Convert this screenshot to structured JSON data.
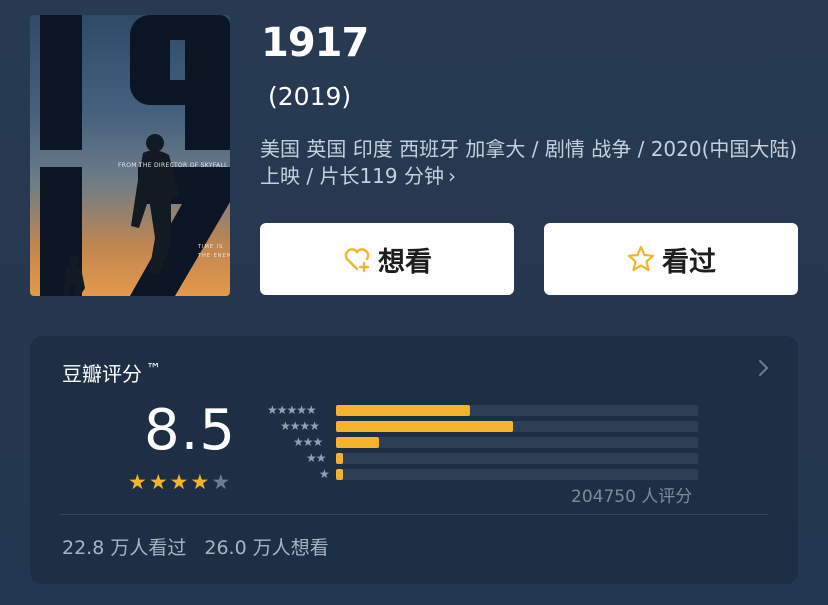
{
  "movie": {
    "title": "1917",
    "year": "(2019)",
    "meta_line": "美国 英国 印度 西班牙 加拿大 / 剧情 战争 / 2020(中国大陆) 上映 / 片长119 分钟",
    "poster": {
      "digits": [
        "1",
        "9",
        "1",
        "7"
      ],
      "director_credit": "FROM THE DIRECTOR OF SKYFALL",
      "tagline": "TIME IS THE ENEMY"
    }
  },
  "actions": {
    "want_label": "想看",
    "seen_label": "看过",
    "want_icon": "heart-plus-icon",
    "seen_icon": "star-outline-icon"
  },
  "rating": {
    "title": "豆瓣评分",
    "tm": "™",
    "score": "8.5",
    "stars_filled": 4,
    "stars_total": 5,
    "star_color": "#f5b32c",
    "distribution": [
      {
        "stars": "★★★★★",
        "percent": 37
      },
      {
        "stars": "★★★★",
        "percent": 49
      },
      {
        "stars": "★★★",
        "percent": 12
      },
      {
        "stars": "★★",
        "percent": 2
      },
      {
        "stars": "★",
        "percent": 2
      }
    ],
    "count_text": "204750 人评分",
    "seen_count": "22.8 万人看过",
    "want_count": "26.0 万人想看"
  }
}
